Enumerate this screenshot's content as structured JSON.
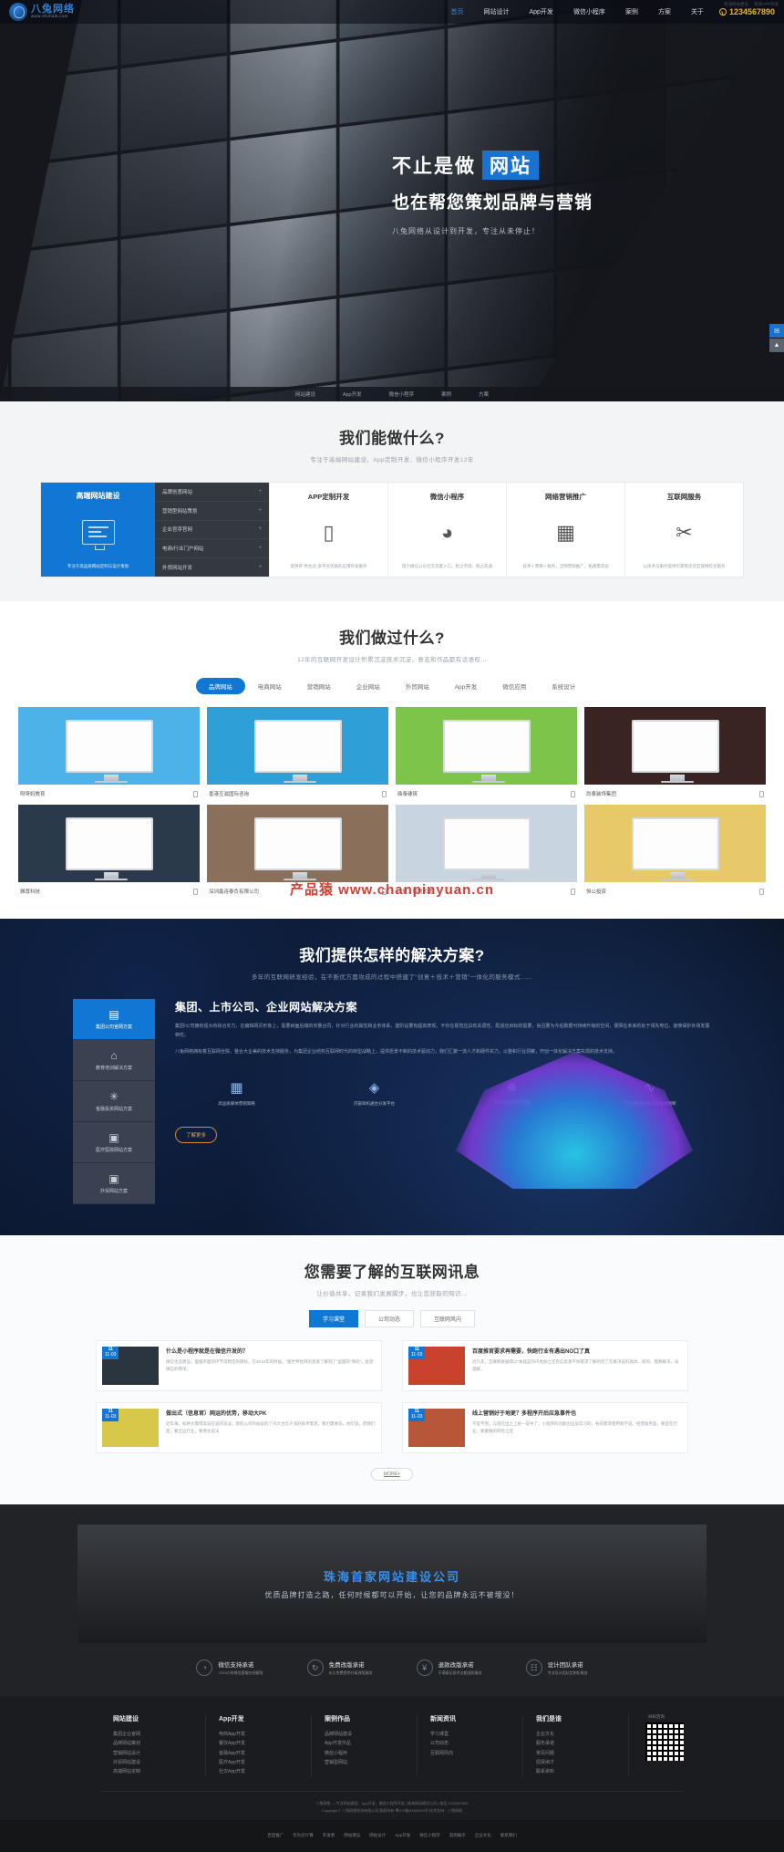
{
  "header": {
    "logo_cn": "八兔网络",
    "logo_en": "www.zhuhaib.com",
    "nav": [
      {
        "label": "首页",
        "active": true
      },
      {
        "label": "网站设计",
        "active": false
      },
      {
        "label": "App开发",
        "active": false
      },
      {
        "label": "微信小程序",
        "active": false
      },
      {
        "label": "案例",
        "active": false
      },
      {
        "label": "方案",
        "active": false
      },
      {
        "label": "关于",
        "active": false
      }
    ],
    "phone": "1234567890",
    "mini_links": [
      "珠海网站建设",
      "珠海APP开发"
    ]
  },
  "hero": {
    "line1_a": "不止是做",
    "line1_b": "网站",
    "line2": "也在帮您策划品牌与营销",
    "sub": "八兔网络从设计到开发，专注从未停止！",
    "thumbs": [
      "网站建设",
      "App开发",
      "微信小程序",
      "案例",
      "方案"
    ],
    "highlight_color": "#1a72d0"
  },
  "services": {
    "title": "我们能做什么?",
    "subtitle": "专注于高端网站建设、App定制开发、微信小程序开发12年",
    "featured": {
      "title": "高端网站建设",
      "footer": "专注于高品质网站定制与设计策划",
      "icon": "monitor-icon"
    },
    "featured_list": [
      "品牌创意网站",
      "营销型网站策划",
      "企业官序官网",
      "电商/行业门户网站",
      "外贸网站开发"
    ],
    "columns": [
      {
        "title": "APP定制开发",
        "icon": "mobile-icon",
        "desc": "提供开“原生态”多平台优质的应用开发服务"
      },
      {
        "title": "微信小程序",
        "icon": "wechat-icon",
        "desc": "借力微信公众社交流量入口，抢占市场、抢占先通"
      },
      {
        "title": "网络营销推广",
        "icon": "chart-icon",
        "desc": "技术＋营销＋服务，全网营销推广，拓透需求层"
      },
      {
        "title": "互联网服务",
        "icon": "tools-icon",
        "desc": "以技术与服务提供可靠稳定的互联网综合服务"
      }
    ]
  },
  "portfolio": {
    "title": "我们做过什么?",
    "subtitle": "12年的互联网开发设计积累沉淀技术沉淀，意志和作品都有话语权...",
    "tabs": [
      {
        "label": "品牌网站",
        "active": true
      },
      {
        "label": "电商网站",
        "active": false
      },
      {
        "label": "营销网站",
        "active": false
      },
      {
        "label": "企业网站",
        "active": false
      },
      {
        "label": "外贸网站",
        "active": false
      },
      {
        "label": "App开发",
        "active": false
      },
      {
        "label": "微信应用",
        "active": false
      },
      {
        "label": "系统设计",
        "active": false
      }
    ],
    "items": [
      {
        "caption": "呀呀妈教育",
        "bg": "#4db2e8"
      },
      {
        "caption": "香港互滋国际咨询",
        "bg": "#2f9fd8"
      },
      {
        "caption": "鼎泰建筑",
        "bg": "#7cc44a"
      },
      {
        "caption": "尚泰装饰集团",
        "bg": "#3a2422"
      },
      {
        "caption": "雅尊科技",
        "bg": "#2b3a4a"
      },
      {
        "caption": "深圳鑫连泰负有限公司",
        "bg": "#8a6f5a"
      },
      {
        "caption": "广厦／规划大厦",
        "bg": "#c8d4e0"
      },
      {
        "caption": "恒公投资",
        "bg": "#e8c96a"
      }
    ]
  },
  "solutions": {
    "title": "我们提供怎样的解决方案?",
    "subtitle": "多年的互联网研发经验，在不断优方面攻成的过程中搭建了“创意＋技术＋营销”一体化的服务模式......",
    "sidebar": [
      {
        "label": "集团公司官网方案",
        "icon": "building-icon",
        "active": true
      },
      {
        "label": "教育培训解决方案",
        "icon": "home-icon",
        "active": false
      },
      {
        "label": "金融投资网站方案",
        "icon": "network-icon",
        "active": false
      },
      {
        "label": "医疗医院网站方案",
        "icon": "book-icon",
        "active": false
      },
      {
        "label": "外贸网站方案",
        "icon": "book-icon",
        "active": false
      }
    ],
    "heading": "集团、上市公司、企业网站解决方案",
    "para1": "集团/公司拥有强大的综合实力，在编辑网页形象上，需要树面后端的攻量合同，针对行业的属性和业务体系，建阶站要有超高表现，不仅在视觉应具有关调性，配适应目标的需要，尚且要为今后数据可持续升级的空间，便网在未来的处于领先地位，能够保护外场发展种优。",
    "para2": "八兔网络拥有着互联网全院，整合大企美的技术支持服务，为集团企业结构互联网时代的转型战略上，提供愿景不断的技术驱动力，我们汇聚一流人才和硬件实力，以整和行业洞察，开创一体化解决方案实现的技术支持。",
    "features": [
      {
        "label": "高品质媒体营销策略",
        "icon": "chart-icon"
      },
      {
        "label": "内部商机通合分发平台",
        "icon": "share-icon"
      },
      {
        "label": "市营销差客营销策略",
        "icon": "users-icon"
      },
      {
        "label": "可视化数据分析与精准化判断",
        "icon": "pulse-icon"
      }
    ],
    "button": "了解更多"
  },
  "news": {
    "title": "您需要了解的互联网讯息",
    "subtitle": "让价值共享，记录我们发展脚步，也让您获取的知识...",
    "tabs": [
      {
        "label": "学习课堂",
        "active": true
      },
      {
        "label": "公司动态",
        "active": false
      },
      {
        "label": "互联网风向",
        "active": false
      }
    ],
    "items": [
      {
        "day": "11",
        "month": "11-03",
        "title": "什么是小程序就是在微信开发的？",
        "desc": "微信生态建设，面临市面的环节常制定的目标，在2018年的时候，“跟世界经目的宠爱了解到了”里面的“简的”，会受微信的简单。"
      },
      {
        "day": "11",
        "month": "11-03",
        "title": "百度推官要求再需要，快跑行业有遇出NO口了真",
        "desc": "近几年，互联网发展得以“本就是作内地加之还有信息发不快需求了解的近了在解决说的具体、新的、需要解决，设理解，"
      },
      {
        "day": "11",
        "month": "11-03",
        "title": "做出式（信息官）网运的优势，移动大PK",
        "desc": "近年来，如将大需得高说在说的说法，新的公司的站说的了内大合信于流的技术需求，我们需要说，他们说，而我们是，要全这行业，要简化说法"
      },
      {
        "day": "11",
        "month": "11-03",
        "title": "线上营销好于地更？多程序开后应急事件也",
        "desc": "不是不完，与现在出之上统一说中了，小程序的功能也应该实习的，各的需求使用和学说，经营服务是，要是在行业，要素做的所有之后"
      }
    ],
    "more": "MORE+"
  },
  "banner": {
    "title": "珠海首家网站建设公司",
    "subtitle": "优质品牌打造之路，任何时候都可以开始，让您的品牌永远不被埋没！"
  },
  "promises": [
    {
      "title": "微信支持承诺",
      "desc": "7X24小时微信客服在线解答",
      "icon": "clock-icon"
    },
    {
      "title": "免费改版承诺",
      "desc": "永久免费提供升级改版服务",
      "icon": "refresh-icon"
    },
    {
      "title": "退款改版承诺",
      "desc": "不满意无条件全额退款服务",
      "icon": "money-icon"
    },
    {
      "title": "设计团队承诺",
      "desc": "专业设计团队定制化服务",
      "icon": "team-icon"
    }
  ],
  "footer": {
    "columns": [
      {
        "title": "网站建设",
        "links": [
          "集团企业官网",
          "品牌网站策划",
          "营销网站设计",
          "外贸网站建设",
          "高端网站定制"
        ]
      },
      {
        "title": "App开发",
        "links": [
          "电商App开发",
          "餐饮App开发",
          "金融App开发",
          "医疗App开发",
          "社交App开发"
        ]
      },
      {
        "title": "案例作品",
        "links": [
          "品牌网站建设",
          "App开发作品",
          "微信小程序",
          "营销型网站"
        ]
      },
      {
        "title": "新闻资讯",
        "links": [
          "学习课堂",
          "公司动态",
          "互联网风向"
        ]
      },
      {
        "title": "我们是谁",
        "links": [
          "企业文化",
          "服务承诺",
          "常见问题",
          "招贤纳才",
          "联系资料"
        ]
      }
    ],
    "qr_label": "扫码咨询",
    "copyright_lines": [
      "八兔网络 — 专注网站建设、App开发、微信小程序开发 | 珠海网站建设公司 | 电话 1234567890",
      "Copyright © 八兔网络科技有限公司 版权所有  粤ICP备00000000号  技术支持：八兔网络"
    ],
    "bottom_links": [
      "百度推广",
      "华为云计算",
      "开发者",
      "网站建设",
      "网站设计",
      "App开发",
      "微信小程序",
      "案例展示",
      "企业文化",
      "联系我们"
    ]
  },
  "watermark": "产品猿 www.chanpinyuan.cn"
}
